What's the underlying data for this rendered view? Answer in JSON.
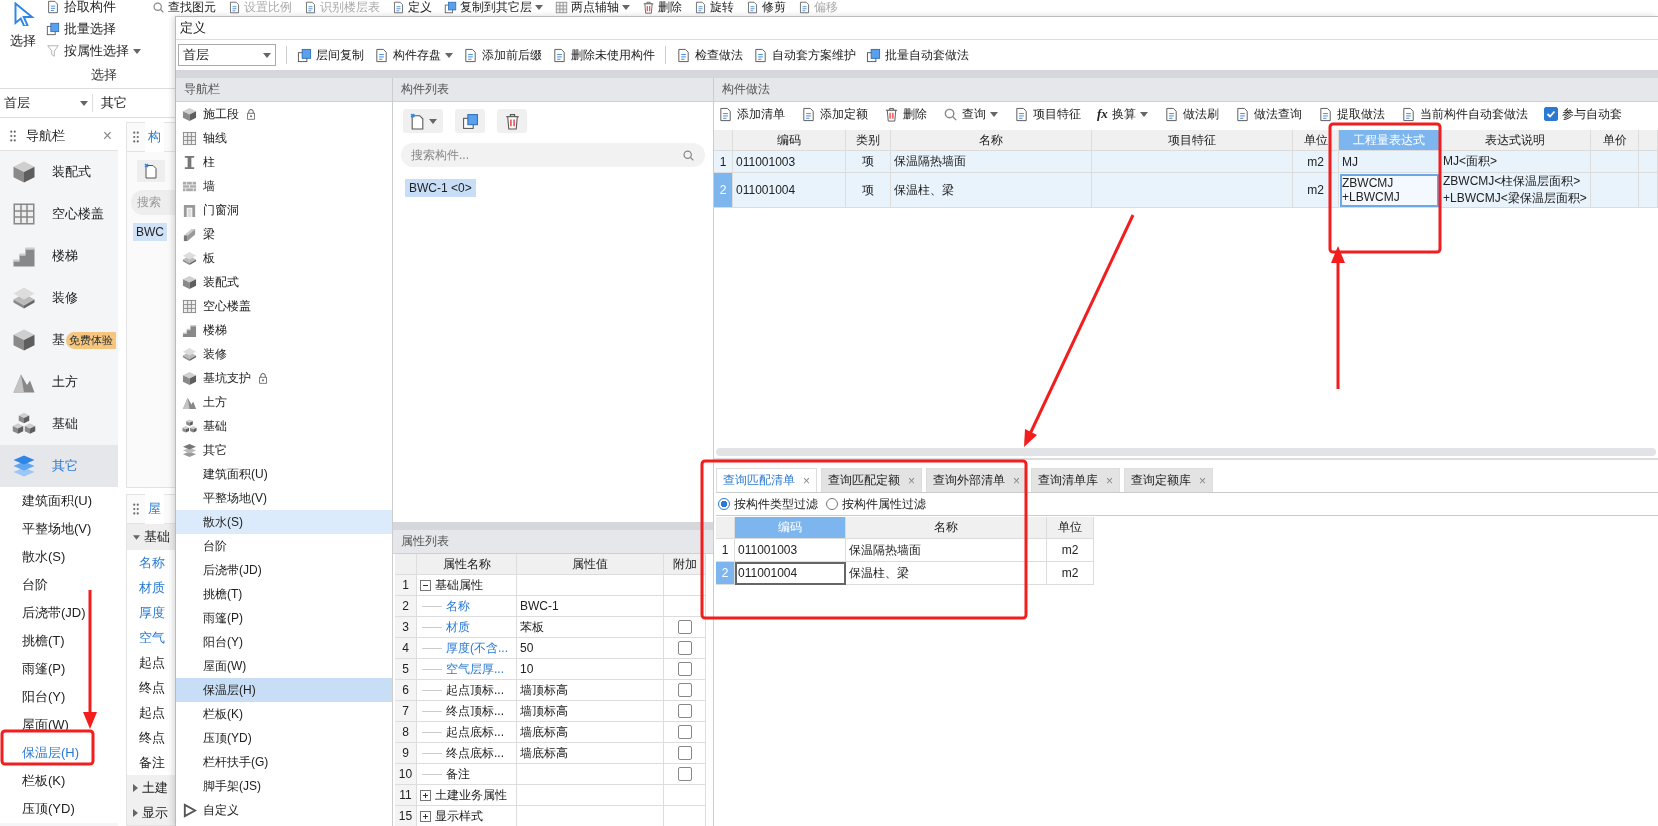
{
  "ribbon": {
    "select_button": {
      "label": "选择"
    },
    "tools": [
      {
        "label": "拾取构件",
        "dropdown": false
      },
      {
        "label": "批量选择",
        "dropdown": false
      },
      {
        "label": "按属性选择",
        "dropdown": true
      }
    ],
    "group_label": "选择",
    "top_items": [
      {
        "label": "查找图元",
        "disabled": false,
        "dropdown": false
      },
      {
        "label": "设置比例",
        "disabled": true,
        "dropdown": false
      },
      {
        "label": "识别楼层表",
        "disabled": true,
        "dropdown": false
      },
      {
        "label": "定义",
        "disabled": false,
        "dropdown": false
      },
      {
        "label": "复制到其它层",
        "disabled": false,
        "dropdown": true
      },
      {
        "label": "两点辅轴",
        "disabled": false,
        "dropdown": true
      },
      {
        "label": "删除",
        "disabled": false,
        "dropdown": false
      },
      {
        "label": "旋转",
        "disabled": false,
        "dropdown": false
      },
      {
        "label": "修剪",
        "disabled": false,
        "dropdown": false
      },
      {
        "label": "偏移",
        "disabled": true,
        "dropdown": false
      }
    ]
  },
  "floor_bar": {
    "floor": "首层",
    "category": "其它"
  },
  "side_nav": {
    "title": "导航栏",
    "close": "×",
    "categories": [
      {
        "label": "装配式",
        "selected": false
      },
      {
        "label": "空心楼盖",
        "selected": false
      },
      {
        "label": "楼梯",
        "selected": false
      },
      {
        "label": "装修",
        "selected": false
      },
      {
        "label": "基",
        "badge": "免费体验",
        "selected": false
      },
      {
        "label": "土方",
        "selected": false
      },
      {
        "label": "基础",
        "selected": false
      },
      {
        "label": "其它",
        "selected": true
      }
    ],
    "items": [
      {
        "label": "建筑面积(U)",
        "selected": false
      },
      {
        "label": "平整场地(V)",
        "selected": false
      },
      {
        "label": "散水(S)",
        "selected": false
      },
      {
        "label": "台阶",
        "selected": false
      },
      {
        "label": "后浇带(JD)",
        "selected": false
      },
      {
        "label": "挑檐(T)",
        "selected": false
      },
      {
        "label": "雨篷(P)",
        "selected": false
      },
      {
        "label": "阳台(Y)",
        "selected": false
      },
      {
        "label": "屋面(W)",
        "selected": false
      },
      {
        "label": "保温层(H)",
        "selected": true
      },
      {
        "label": "栏板(K)",
        "selected": false
      },
      {
        "label": "压顶(YD)",
        "selected": false
      }
    ]
  },
  "back_list": {
    "tab": "构",
    "search": {
      "placeholder": "搜索"
    },
    "tag": "BWC"
  },
  "back_props": {
    "tab": "屋",
    "group": "基础",
    "rows": [
      {
        "label": "名称",
        "emphasized": true
      },
      {
        "label": "材质",
        "emphasized": true
      },
      {
        "label": "厚度",
        "emphasized": true
      },
      {
        "label": "空气",
        "emphasized": true
      },
      {
        "label": "起点",
        "emphasized": false
      },
      {
        "label": "终点",
        "emphasized": false
      },
      {
        "label": "起点",
        "emphasized": false
      },
      {
        "label": "终点",
        "emphasized": false
      },
      {
        "label": "备注",
        "emphasized": false
      }
    ],
    "sections": [
      "土建",
      "显示"
    ]
  },
  "dialog": {
    "title": "定义",
    "floor": "首层",
    "toolbar": [
      [
        {
          "label": "层间复制",
          "dropdown": false
        },
        {
          "label": "构件存盘",
          "dropdown": true
        },
        {
          "label": "添加前后缀",
          "dropdown": false
        },
        {
          "label": "删除未使用构件",
          "dropdown": false
        }
      ],
      [
        {
          "label": "检查做法",
          "dropdown": false
        },
        {
          "label": "自动套方案维护",
          "dropdown": false
        },
        {
          "label": "批量自动套做法",
          "dropdown": false
        }
      ]
    ],
    "nav": {
      "title": "导航栏",
      "items": [
        {
          "label": "施工段",
          "locked": true,
          "selected": false,
          "hovered": false
        },
        {
          "label": "轴线",
          "locked": false,
          "selected": false,
          "hovered": false
        },
        {
          "label": "柱",
          "locked": false,
          "selected": false,
          "hovered": false
        },
        {
          "label": "墙",
          "locked": false,
          "selected": false,
          "hovered": false
        },
        {
          "label": "门窗洞",
          "locked": false,
          "selected": false,
          "hovered": false
        },
        {
          "label": "梁",
          "locked": false,
          "selected": false,
          "hovered": false
        },
        {
          "label": "板",
          "locked": false,
          "selected": false,
          "hovered": false
        },
        {
          "label": "装配式",
          "locked": false,
          "selected": false,
          "hovered": false
        },
        {
          "label": "空心楼盖",
          "locked": false,
          "selected": false,
          "hovered": false
        },
        {
          "label": "楼梯",
          "locked": false,
          "selected": false,
          "hovered": false
        },
        {
          "label": "装修",
          "locked": false,
          "selected": false,
          "hovered": false
        },
        {
          "label": "基坑支护",
          "locked": true,
          "selected": false,
          "hovered": false
        },
        {
          "label": "土方",
          "locked": false,
          "selected": false,
          "hovered": false
        },
        {
          "label": "基础",
          "locked": false,
          "selected": false,
          "hovered": false
        },
        {
          "label": "其它",
          "locked": false,
          "selected": false,
          "hovered": false,
          "children": [
            {
              "label": "建筑面积(U)",
              "selected": false,
              "hovered": false
            },
            {
              "label": "平整场地(V)",
              "selected": false,
              "hovered": false
            },
            {
              "label": "散水(S)",
              "selected": false,
              "hovered": true
            },
            {
              "label": "台阶",
              "selected": false,
              "hovered": false
            },
            {
              "label": "后浇带(JD)",
              "selected": false,
              "hovered": false
            },
            {
              "label": "挑檐(T)",
              "selected": false,
              "hovered": false
            },
            {
              "label": "雨篷(P)",
              "selected": false,
              "hovered": false
            },
            {
              "label": "阳台(Y)",
              "selected": false,
              "hovered": false
            },
            {
              "label": "屋面(W)",
              "selected": false,
              "hovered": false
            },
            {
              "label": "保温层(H)",
              "selected": true,
              "hovered": false
            },
            {
              "label": "栏板(K)",
              "selected": false,
              "hovered": false
            },
            {
              "label": "压顶(YD)",
              "selected": false,
              "hovered": false
            },
            {
              "label": "栏杆扶手(G)",
              "selected": false,
              "hovered": false
            },
            {
              "label": "脚手架(JS)",
              "selected": false,
              "hovered": false
            }
          ]
        },
        {
          "label": "自定义",
          "locked": false,
          "selected": false,
          "hovered": false
        }
      ]
    },
    "component_list": {
      "title": "构件列表",
      "search": {
        "placeholder": "搜索构件..."
      },
      "items": [
        {
          "label": "BWC-1 <0>",
          "selected": true
        }
      ]
    },
    "property_list": {
      "title": "属性列表",
      "columns": [
        "属性名称",
        "属性值",
        "附加"
      ],
      "rows": [
        {
          "index": "1",
          "name": "基础属性",
          "kind": "group",
          "expanded": true
        },
        {
          "index": "2",
          "name": "名称",
          "value": "BWC-1",
          "kind": "field",
          "emphasized": true
        },
        {
          "index": "3",
          "name": "材质",
          "value": "苯板",
          "kind": "field",
          "emphasized": true,
          "checked": false
        },
        {
          "index": "4",
          "name": "厚度(不含...",
          "value": "50",
          "kind": "field",
          "emphasized": true,
          "checked": false
        },
        {
          "index": "5",
          "name": "空气层厚...",
          "value": "10",
          "kind": "field",
          "emphasized": true,
          "checked": false
        },
        {
          "index": "6",
          "name": "起点顶标...",
          "value": "墙顶标高",
          "kind": "field",
          "emphasized": false,
          "checked": false
        },
        {
          "index": "7",
          "name": "终点顶标...",
          "value": "墙顶标高",
          "kind": "field",
          "emphasized": false,
          "checked": false
        },
        {
          "index": "8",
          "name": "起点底标...",
          "value": "墙底标高",
          "kind": "field",
          "emphasized": false,
          "checked": false
        },
        {
          "index": "9",
          "name": "终点底标...",
          "value": "墙底标高",
          "kind": "field",
          "emphasized": false,
          "checked": false
        },
        {
          "index": "10",
          "name": "备注",
          "kind": "field",
          "emphasized": false,
          "checked": false
        },
        {
          "index": "11",
          "name": "土建业务属性",
          "kind": "group",
          "expanded": false
        },
        {
          "index": "15",
          "name": "显示样式",
          "kind": "group",
          "expanded": false
        }
      ]
    },
    "method": {
      "title": "构件做法",
      "toolbar": [
        {
          "label": "添加清单",
          "kind": "button",
          "dropdown": false
        },
        {
          "label": "添加定额",
          "kind": "button",
          "dropdown": false
        },
        {
          "label": "删除",
          "kind": "button",
          "dropdown": false
        },
        {
          "label": "查询",
          "kind": "button",
          "dropdown": true
        },
        {
          "label": "项目特征",
          "kind": "button",
          "dropdown": false
        },
        {
          "label": "换算",
          "kind": "button",
          "dropdown": true,
          "icon_text": "fx"
        },
        {
          "label": "做法刷",
          "kind": "button",
          "dropdown": false
        },
        {
          "label": "做法查询",
          "kind": "button",
          "dropdown": false
        },
        {
          "label": "提取做法",
          "kind": "button",
          "dropdown": false
        },
        {
          "label": "当前构件自动套做法",
          "kind": "button",
          "dropdown": false
        },
        {
          "label": "参与自动套",
          "kind": "checkbox",
          "checked": true
        }
      ],
      "table": {
        "columns": [
          {
            "label": "编码",
            "selected": false
          },
          {
            "label": "类别",
            "selected": false
          },
          {
            "label": "名称",
            "selected": false
          },
          {
            "label": "项目特征",
            "selected": false
          },
          {
            "label": "单位",
            "selected": false
          },
          {
            "label": "工程量表达式",
            "selected": true
          },
          {
            "label": "表达式说明",
            "selected": false
          },
          {
            "label": "单价",
            "selected": false
          }
        ],
        "rows": [
          {
            "index": "1",
            "code": "011001003",
            "category": "项",
            "name": "保温隔热墙面",
            "unit": "m2",
            "expression": "MJ",
            "description": "MJ<面积>",
            "selected": false
          },
          {
            "index": "2",
            "code": "011001004",
            "category": "项",
            "name": "保温柱、梁",
            "unit": "m2",
            "expression": "ZBWCMJ\n+LBWCMJ",
            "description": "ZBWCMJ<柱保温层面积>+LBWCMJ<梁保温层面积>",
            "selected": true
          }
        ]
      }
    },
    "query": {
      "tabs": [
        {
          "label": "查询匹配清单",
          "close": "×",
          "selected": true
        },
        {
          "label": "查询匹配定额",
          "close": "×",
          "selected": false
        },
        {
          "label": "查询外部清单",
          "close": "×",
          "selected": false
        },
        {
          "label": "查询清单库",
          "close": "×",
          "selected": false
        },
        {
          "label": "查询定额库",
          "close": "×",
          "selected": false
        }
      ],
      "filters": [
        {
          "label": "按构件类型过滤",
          "selected": true
        },
        {
          "label": "按构件属性过滤",
          "selected": false
        }
      ],
      "table": {
        "columns": [
          {
            "label": "编码",
            "selected": true
          },
          {
            "label": "名称",
            "selected": false
          },
          {
            "label": "单位",
            "selected": false
          }
        ],
        "rows": [
          {
            "index": "1",
            "code": "011001003",
            "name": "保温隔热墙面",
            "unit": "m2",
            "selected": false
          },
          {
            "index": "2",
            "code": "011001004",
            "name": "保温柱、梁",
            "unit": "m2",
            "selected": true
          }
        ]
      }
    }
  }
}
